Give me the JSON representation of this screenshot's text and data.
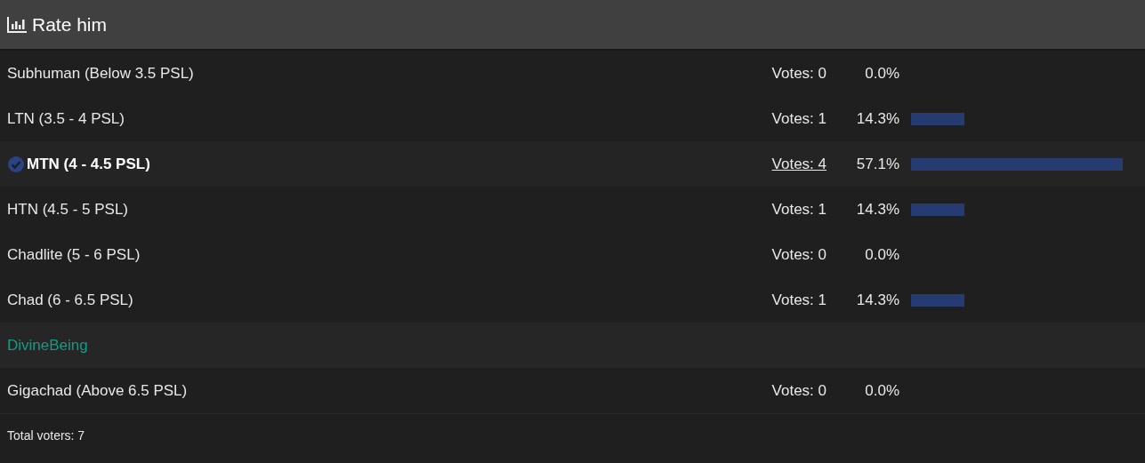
{
  "poll": {
    "title": "Rate him",
    "options": [
      {
        "label": "Subhuman (Below 3.5 PSL)",
        "voted": false,
        "votes": "Votes: 0",
        "percent": "0.0%"
      },
      {
        "label": "LTN (3.5 - 4 PSL)",
        "voted": false,
        "votes": "Votes: 1",
        "percent": "14.3%"
      },
      {
        "label": "MTN (4 - 4.5 PSL)",
        "voted": true,
        "votes": "Votes: 4",
        "percent": "57.1%"
      },
      {
        "label": "HTN (4.5 - 5 PSL)",
        "voted": false,
        "votes": "Votes: 1",
        "percent": "14.3%"
      },
      {
        "label": "Chadlite (5 - 6 PSL)",
        "voted": false,
        "votes": "Votes: 0",
        "percent": "0.0%"
      },
      {
        "label": "Chad (6 - 6.5 PSL)",
        "voted": false,
        "votes": "Votes: 1",
        "percent": "14.3%",
        "voters": [
          {
            "name": "DivineBeing"
          }
        ]
      },
      {
        "label": "Gigachad (Above 6.5 PSL)",
        "voted": false,
        "votes": "Votes: 0",
        "percent": "0.0%"
      }
    ],
    "footer": "Total voters: 7"
  }
}
